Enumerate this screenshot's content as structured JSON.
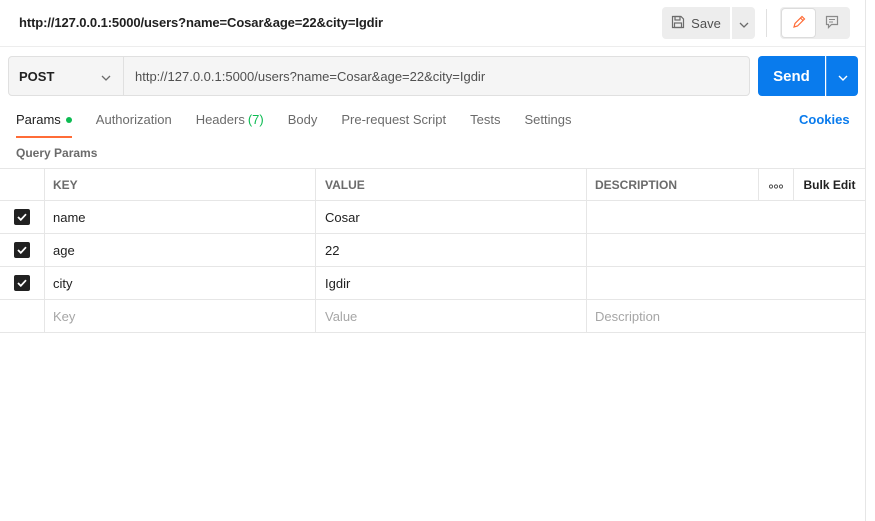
{
  "header": {
    "request_title": "http://127.0.0.1:5000/users?name=Cosar&age=22&city=Igdir",
    "save_label": "Save",
    "icons": {
      "save": "save-icon",
      "caret": "chevron-down-icon",
      "edit": "pencil-icon",
      "comments": "comment-icon"
    }
  },
  "request": {
    "method": "POST",
    "url": "http://127.0.0.1:5000/users?name=Cosar&age=22&city=Igdir",
    "send_label": "Send"
  },
  "tabs": [
    {
      "label": "Params",
      "active": true,
      "indicator": true
    },
    {
      "label": "Authorization"
    },
    {
      "label": "Headers",
      "count": "(7)"
    },
    {
      "label": "Body"
    },
    {
      "label": "Pre-request Script"
    },
    {
      "label": "Tests"
    },
    {
      "label": "Settings"
    }
  ],
  "cookies_label": "Cookies",
  "query_params": {
    "title": "Query Params",
    "columns": {
      "key": "KEY",
      "value": "VALUE",
      "description": "DESCRIPTION",
      "bulk_edit": "Bulk Edit"
    },
    "rows": [
      {
        "checked": true,
        "key": "name",
        "value": "Cosar",
        "description": ""
      },
      {
        "checked": true,
        "key": "age",
        "value": "22",
        "description": ""
      },
      {
        "checked": true,
        "key": "city",
        "value": "Igdir",
        "description": ""
      }
    ],
    "new_row": {
      "key_placeholder": "Key",
      "value_placeholder": "Value",
      "description_placeholder": "Description"
    }
  },
  "colors": {
    "accent": "#097bed",
    "active_tab_underline": "#ff6c37",
    "indicator": "#0cbb52",
    "checkbox": "#212121"
  }
}
